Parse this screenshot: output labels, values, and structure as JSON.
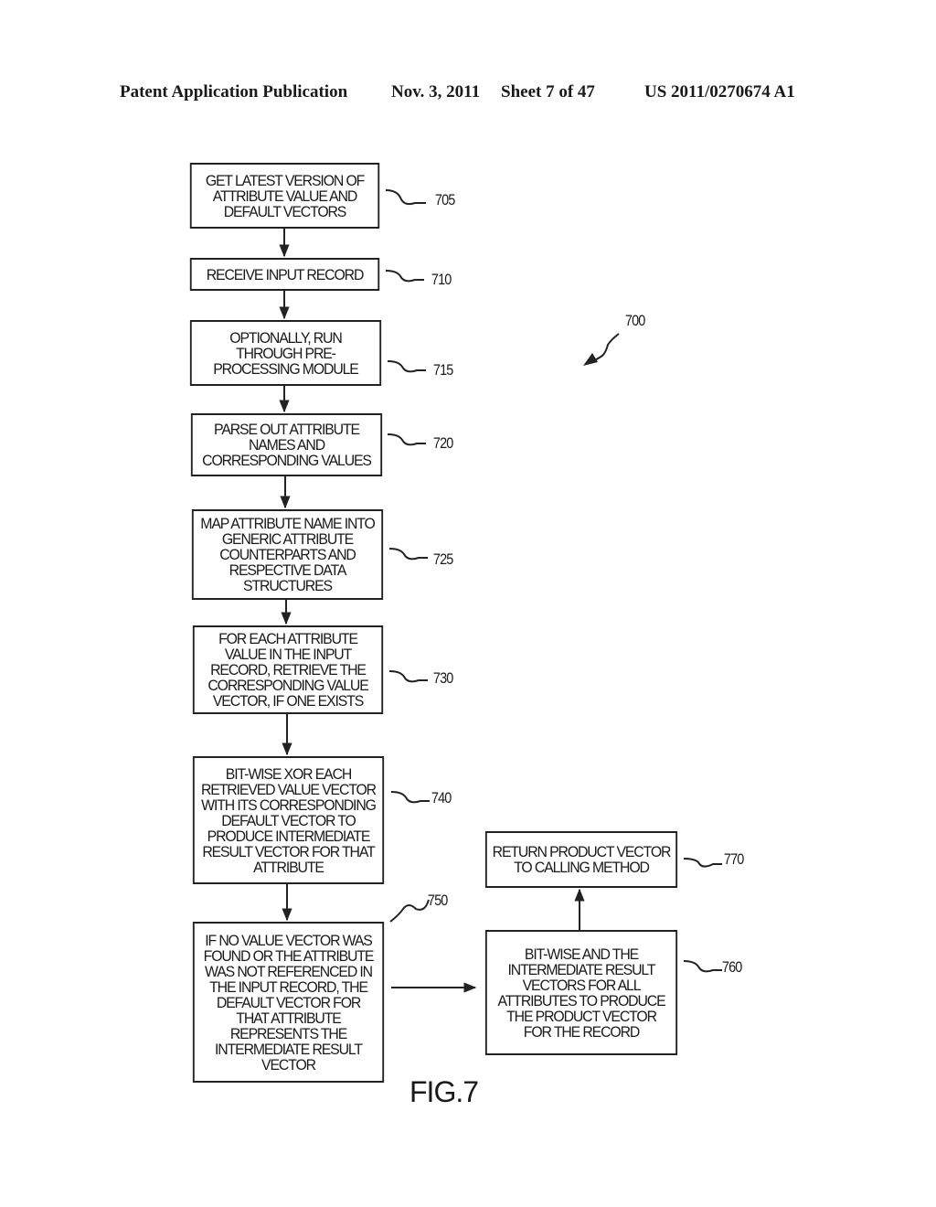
{
  "header": {
    "left": "Patent Application Publication",
    "date": "Nov. 3, 2011",
    "sheet": "Sheet 7 of 47",
    "pub_number": "US 2011/0270674 A1"
  },
  "figure": {
    "label": "FIG.7",
    "ref": "700",
    "steps": [
      {
        "ref": "705",
        "text": "GET LATEST VERSION OF\nATTRIBUTE VALUE AND\nDEFAULT VECTORS"
      },
      {
        "ref": "710",
        "text": "RECEIVE INPUT RECORD"
      },
      {
        "ref": "715",
        "text": "OPTIONALLY, RUN\nTHROUGH PRE-\nPROCESSING MODULE"
      },
      {
        "ref": "720",
        "text": "PARSE OUT ATTRIBUTE\nNAMES AND\nCORRESPONDING VALUES"
      },
      {
        "ref": "725",
        "text": "MAP ATTRIBUTE NAME INTO\nGENERIC ATTRIBUTE\nCOUNTERPARTS AND\nRESPECTIVE DATA\nSTRUCTURES"
      },
      {
        "ref": "730",
        "text": "FOR EACH ATTRIBUTE\nVALUE IN THE INPUT\nRECORD, RETRIEVE THE\nCORRESPONDING VALUE\nVECTOR, IF ONE EXISTS"
      },
      {
        "ref": "740",
        "text": "BIT-WISE XOR EACH\nRETRIEVED VALUE VECTOR\nWITH ITS CORRESPONDING\nDEFAULT VECTOR TO\nPRODUCE INTERMEDIATE\nRESULT VECTOR FOR THAT\nATTRIBUTE"
      },
      {
        "ref": "750",
        "text": "IF NO VALUE VECTOR WAS\nFOUND OR THE ATTRIBUTE\nWAS NOT REFERENCED IN\nTHE INPUT RECORD, THE\nDEFAULT VECTOR FOR\nTHAT ATTRIBUTE\nREPRESENTS THE\nINTERMEDIATE RESULT\nVECTOR"
      },
      {
        "ref": "760",
        "text": "BIT-WISE AND THE\nINTERMEDIATE RESULT\nVECTORS FOR ALL\nATTRIBUTES TO PRODUCE\nTHE PRODUCT VECTOR\nFOR THE RECORD"
      },
      {
        "ref": "770",
        "text": "RETURN PRODUCT VECTOR\nTO CALLING METHOD"
      }
    ]
  }
}
